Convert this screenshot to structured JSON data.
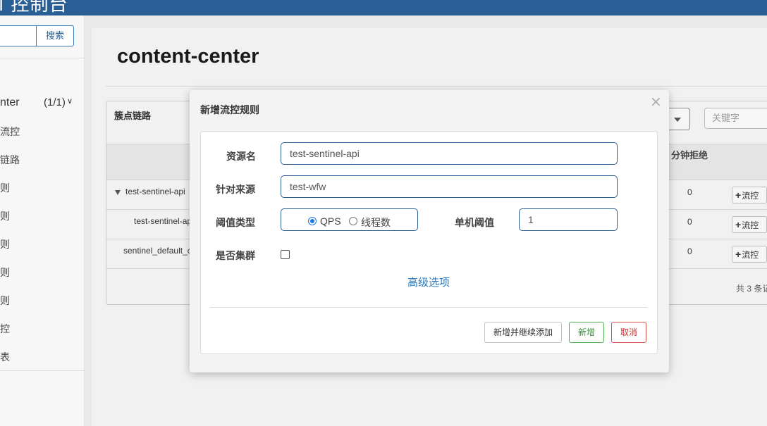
{
  "header": {
    "brand": "l 控制台"
  },
  "sidebar": {
    "search_placeholder": "",
    "search_button": "搜索",
    "app": {
      "name": "nter",
      "count": "(1/1)"
    },
    "items": [
      "流控",
      "链路",
      "则",
      "则",
      "则",
      "则",
      "则",
      "控",
      "表"
    ]
  },
  "main": {
    "page_title": "content-center",
    "panel_label": "簇点链路",
    "keyword_placeholder": "关键字",
    "column_reject": "分钟拒绝",
    "rows": [
      {
        "name": "test-sentinel-api",
        "value": "0",
        "action": "流控"
      },
      {
        "name": "test-sentinel-ap",
        "value": "0",
        "action": "流控"
      },
      {
        "name": "sentinel_default_c",
        "value": "0",
        "action": "流控"
      }
    ],
    "total": "共 3 条记"
  },
  "modal": {
    "title": "新增流控规则",
    "close_symbol": "×",
    "resource_label": "资源名",
    "resource_value": "test-sentinel-api",
    "source_label": "针对来源",
    "source_value": "test-wfw",
    "threshold_type_label": "阈值类型",
    "threshold_options": [
      "QPS",
      "线程数"
    ],
    "threshold_selected": "QPS",
    "single_threshold_label": "单机阈值",
    "single_threshold_value": "1",
    "cluster_label": "是否集群",
    "cluster_checked": false,
    "advanced_link": "高级选项",
    "btn_continue": "新增并继续添加",
    "btn_add": "新增",
    "btn_cancel": "取消"
  },
  "colors": {
    "header": "#2a5f96",
    "primary": "#2a5f96",
    "success": "#4cae4c",
    "danger": "#d9534f",
    "link": "#2a7bbf"
  }
}
